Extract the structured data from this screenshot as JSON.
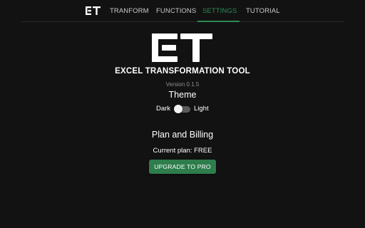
{
  "nav": {
    "logo_icon": "et-logo-icon",
    "tabs": [
      {
        "label": "TRANFORM",
        "active": false
      },
      {
        "label": "FUNCTIONS",
        "active": false
      },
      {
        "label": "SETTINGS",
        "active": true
      },
      {
        "label": "TUTORIAL",
        "active": false
      }
    ],
    "active_color": "#2f8a55"
  },
  "app": {
    "logo_icon": "et-logo-icon",
    "title": "EXCEL TRANSFORMATION TOOL",
    "version": "Version 0.1.5"
  },
  "theme": {
    "heading": "Theme",
    "dark_label": "Dark",
    "light_label": "Light",
    "selected": "Dark"
  },
  "billing": {
    "heading": "Plan and Billing",
    "current_plan": "Current plan: FREE",
    "upgrade_label": "UPGRADE TO PRO",
    "button_color": "#2e7d4c"
  },
  "colors": {
    "background": "#121212",
    "text": "#ffffff",
    "muted": "#8f8f8f"
  }
}
